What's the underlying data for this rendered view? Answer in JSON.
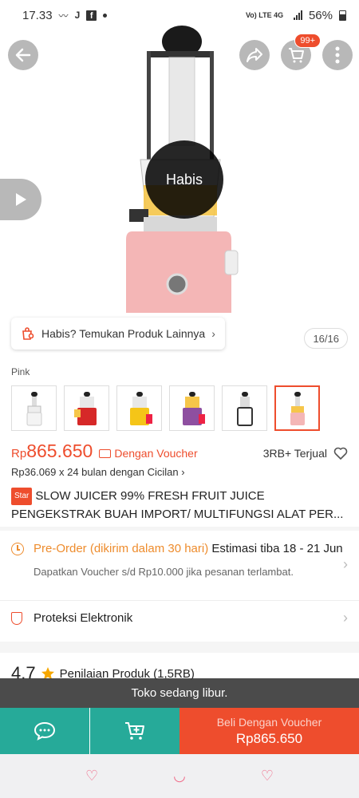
{
  "status_bar": {
    "time": "17.33",
    "network": "Vo) LTE 4G",
    "battery": "56%"
  },
  "hero": {
    "badge": "99+",
    "habis_label": "Habis",
    "habis_pill_label": "Habis? Temukan Produk Lainnya",
    "counter": "16/16"
  },
  "variant": {
    "label": "Pink",
    "thumbs": [
      "white",
      "red",
      "yellow",
      "purple",
      "black-white",
      "pink"
    ],
    "selected_index": 5
  },
  "price": {
    "currency": "Rp",
    "value": "865.650",
    "voucher_label": "Dengan Voucher",
    "sold": "3RB+ Terjual",
    "installment": "Rp36.069 x 24 bulan dengan Cicilan"
  },
  "product": {
    "badge": "Star",
    "title_line1": "SLOW JUICER 99% FRESH FRUIT JUICE",
    "title_line2": "PENGEKSTRAK BUAH IMPORT/ MULTIFUNGSI ALAT PER..."
  },
  "preorder": {
    "highlight": "Pre-Order (dikirim dalam 30 hari)",
    "estimate": " Estimasi tiba 18 - 21 Jun",
    "note": "Dapatkan Voucher s/d Rp10.000 jika pesanan terlambat."
  },
  "protection": {
    "label": "Proteksi Elektronik"
  },
  "rating": {
    "score": "4.7",
    "label": "Penilaian Produk (1,5RB)"
  },
  "toast": {
    "message": "Toko sedang libur."
  },
  "buy": {
    "label": "Beli Dengan Voucher",
    "price": "Rp865.650"
  },
  "colors": {
    "accent": "#ee4d2d",
    "teal": "#26aa99",
    "orange": "#ee8c2d"
  }
}
